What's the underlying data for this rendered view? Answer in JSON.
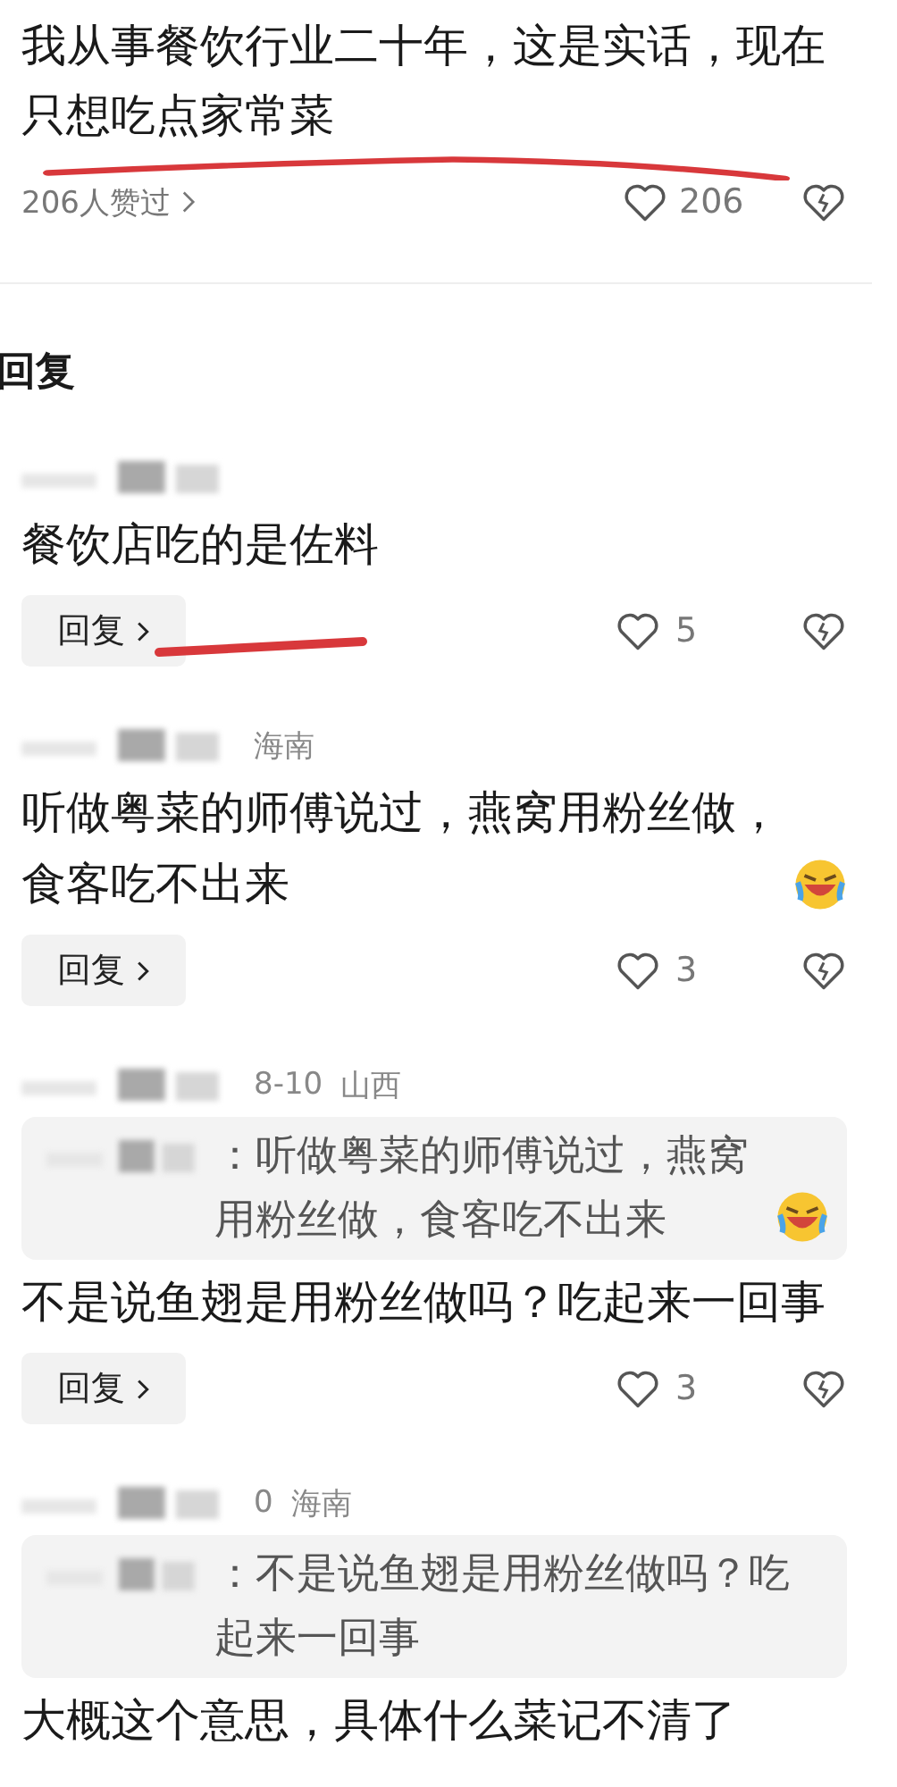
{
  "post": {
    "text": "我从事餐饮行业二十年，这是实话，现在只想吃点家常菜",
    "likers": "206人赞过",
    "like_count": "206"
  },
  "section_title": "回复",
  "replies": [
    {
      "text": "餐饮店吃的是佐料",
      "emoji": false,
      "reply_label": "回复",
      "like_count": "5",
      "marked": true
    },
    {
      "meta": [
        "海南"
      ],
      "text": "听做粤菜的师傅说过，燕窝用粉丝做，食客吃不出来",
      "emoji": true,
      "reply_label": "回复",
      "like_count": "3",
      "marked": false
    },
    {
      "meta": [
        "8-10",
        "山西"
      ],
      "quote": {
        "text": "：听做粤菜的师傅说过，燕窝用粉丝做，食客吃不出来",
        "emoji": true
      },
      "text": "不是说鱼翅是用粉丝做吗？吃起来一回事",
      "emoji": false,
      "reply_label": "回复",
      "like_count": "3",
      "marked": false
    },
    {
      "meta": [
        "0",
        "海南"
      ],
      "quote": {
        "text": "：不是说鱼翅是用粉丝做吗？吃起来一回事",
        "emoji": false
      },
      "text": "大概这个意思，具体什么菜记不清了",
      "emoji": false,
      "marked": false
    }
  ]
}
